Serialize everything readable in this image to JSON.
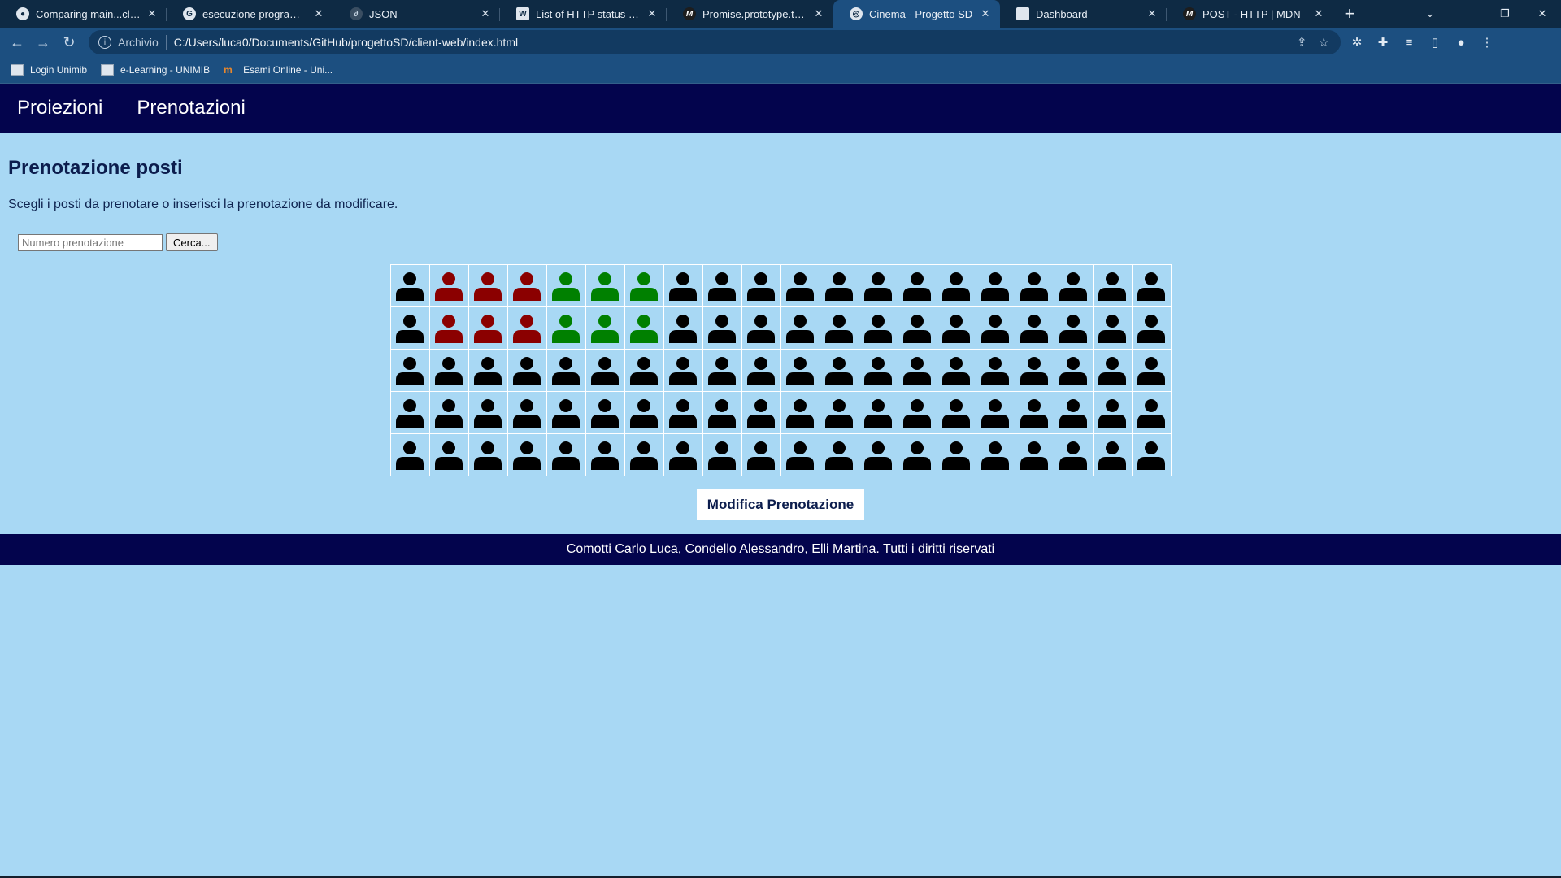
{
  "browser": {
    "tabs": [
      {
        "title": "Comparing main...clientBr",
        "icon": "github-icon",
        "glyph": "●"
      },
      {
        "title": "esecuzione programmi mu",
        "icon": "google-icon",
        "glyph": "G"
      },
      {
        "title": "JSON",
        "icon": "json-icon",
        "glyph": "∂"
      },
      {
        "title": "List of HTTP status codes",
        "icon": "wikipedia-icon",
        "glyph": "W"
      },
      {
        "title": "Promise.prototype.then()",
        "icon": "mdn-icon",
        "glyph": "M"
      },
      {
        "title": "Cinema - Progetto SD",
        "icon": "globe-icon",
        "glyph": "◎"
      },
      {
        "title": "Dashboard",
        "icon": "page-icon",
        "glyph": ""
      },
      {
        "title": "POST - HTTP | MDN",
        "icon": "mdn-icon",
        "glyph": "M"
      }
    ],
    "address": {
      "chip": "Archivio",
      "url": "C:/Users/luca0/Documents/GitHub/progettoSD/client-web/index.html"
    },
    "bookmarks": [
      {
        "label": "Login Unimib"
      },
      {
        "label": "e-Learning - UNIMIB"
      },
      {
        "label": "Esami Online - Uni..."
      }
    ]
  },
  "nav": {
    "projections": "Proiezioni",
    "bookings": "Prenotazioni"
  },
  "page": {
    "title": "Prenotazione posti",
    "description": "Scegli i posti da prenotare o inserisci la prenotazione da modificare.",
    "search_placeholder": "Numero prenotazione",
    "search_button": "Cerca...",
    "modify_button": "Modifica Prenotazione"
  },
  "seats": {
    "rows": [
      [
        "free",
        "occupied",
        "occupied",
        "occupied",
        "selected",
        "selected",
        "selected",
        "free",
        "free",
        "free",
        "free",
        "free",
        "free",
        "free",
        "free",
        "free",
        "free",
        "free",
        "free",
        "free"
      ],
      [
        "free",
        "occupied",
        "occupied",
        "occupied",
        "selected",
        "selected",
        "selected",
        "free",
        "free",
        "free",
        "free",
        "free",
        "free",
        "free",
        "free",
        "free",
        "free",
        "free",
        "free",
        "free"
      ],
      [
        "free",
        "free",
        "free",
        "free",
        "free",
        "free",
        "free",
        "free",
        "free",
        "free",
        "free",
        "free",
        "free",
        "free",
        "free",
        "free",
        "free",
        "free",
        "free",
        "free"
      ],
      [
        "free",
        "free",
        "free",
        "free",
        "free",
        "free",
        "free",
        "free",
        "free",
        "free",
        "free",
        "free",
        "free",
        "free",
        "free",
        "free",
        "free",
        "free",
        "free",
        "free"
      ],
      [
        "free",
        "free",
        "free",
        "free",
        "free",
        "free",
        "free",
        "free",
        "free",
        "free",
        "free",
        "free",
        "free",
        "free",
        "free",
        "free",
        "free",
        "free",
        "free",
        "free"
      ]
    ],
    "colors": {
      "free": "#000000",
      "occupied": "#8b0000",
      "selected": "#008000"
    }
  },
  "footer": {
    "text": "Comotti Carlo Luca, Condello Alessandro, Elli Martina. Tutti i diritti riservati"
  }
}
